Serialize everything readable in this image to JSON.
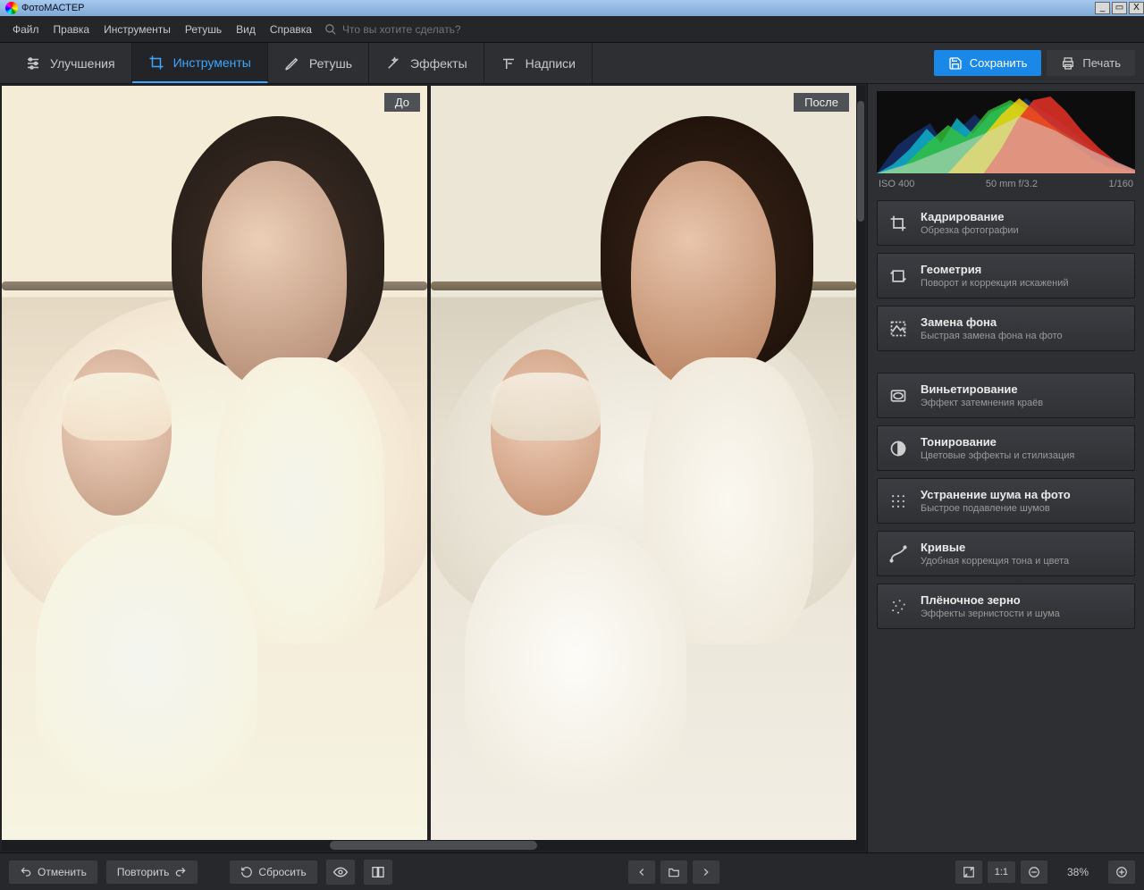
{
  "title": "ФотоМАСТЕР",
  "menubar": {
    "items": [
      "Файл",
      "Правка",
      "Инструменты",
      "Ретушь",
      "Вид",
      "Справка"
    ],
    "search_placeholder": "Что вы хотите сделать?"
  },
  "tabs": {
    "items": [
      {
        "label": "Улучшения",
        "icon": "sliders-icon"
      },
      {
        "label": "Инструменты",
        "icon": "crop-icon"
      },
      {
        "label": "Ретушь",
        "icon": "brush-icon"
      },
      {
        "label": "Эффекты",
        "icon": "wand-icon"
      },
      {
        "label": "Надписи",
        "icon": "text-icon"
      }
    ],
    "active_index": 1,
    "save_label": "Сохранить",
    "print_label": "Печать"
  },
  "compare": {
    "before": "До",
    "after": "После"
  },
  "meta": {
    "iso": "ISO 400",
    "lens": "50 mm f/3.2",
    "shutter": "1/160"
  },
  "tools": [
    {
      "title": "Кадрирование",
      "desc": "Обрезка фотографии",
      "icon": "crop-icon"
    },
    {
      "title": "Геометрия",
      "desc": "Поворот и коррекция искажений",
      "icon": "geometry-icon"
    },
    {
      "title": "Замена фона",
      "desc": "Быстрая замена фона на фото",
      "icon": "bg-replace-icon"
    },
    {
      "title": "Виньетирование",
      "desc": "Эффект затемнения краёв",
      "icon": "vignette-icon"
    },
    {
      "title": "Тонирование",
      "desc": "Цветовые эффекты и стилизация",
      "icon": "toning-icon"
    },
    {
      "title": "Устранение шума на фото",
      "desc": "Быстрое подавление шумов",
      "icon": "denoise-icon"
    },
    {
      "title": "Кривые",
      "desc": "Удобная коррекция тона и цвета",
      "icon": "curves-icon"
    },
    {
      "title": "Плёночное зерно",
      "desc": "Эффекты зернистости и шума",
      "icon": "grain-icon"
    }
  ],
  "bottombar": {
    "undo": "Отменить",
    "redo": "Повторить",
    "reset": "Сбросить",
    "zoom_text": "38%",
    "fit_label": "1:1"
  }
}
